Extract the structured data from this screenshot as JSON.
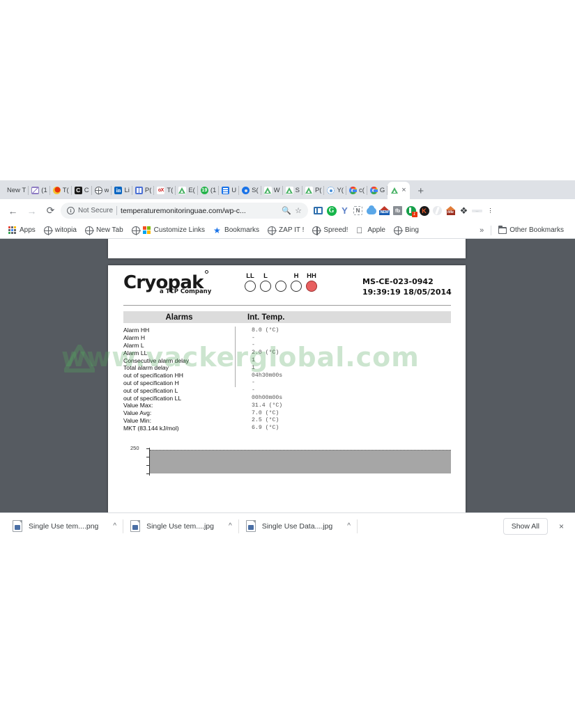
{
  "browser": {
    "tabs": [
      {
        "label": "New T",
        "icon": "none",
        "active": false
      },
      {
        "label": "(1",
        "icon": "mail-icon",
        "active": false
      },
      {
        "label": "T(",
        "icon": "red-dot-icon",
        "active": false
      },
      {
        "label": "C",
        "icon": "letter-c-icon",
        "active": false
      },
      {
        "label": "w",
        "icon": "globe-icon",
        "active": false
      },
      {
        "label": "Li",
        "icon": "linkedin-icon",
        "active": false
      },
      {
        "label": "P(",
        "icon": "blue-app-icon",
        "active": false
      },
      {
        "label": "T(",
        "icon": "ox-icon",
        "active": false
      },
      {
        "label": "E(",
        "icon": "green-triangle-icon",
        "active": false
      },
      {
        "label": "(1",
        "icon": "green-circle-icon",
        "active": false
      },
      {
        "label": "U",
        "icon": "document-icon",
        "active": false
      },
      {
        "label": "S(",
        "icon": "gear-icon",
        "active": false
      },
      {
        "label": "W",
        "icon": "green-triangle-icon",
        "active": false
      },
      {
        "label": "S",
        "icon": "green-triangle-icon",
        "active": false
      },
      {
        "label": "P(",
        "icon": "green-triangle-icon",
        "active": false
      },
      {
        "label": "Y(",
        "icon": "target-icon",
        "active": false
      },
      {
        "label": "c(",
        "icon": "google-icon",
        "active": false
      },
      {
        "label": "G",
        "icon": "google-icon",
        "active": false
      },
      {
        "label": "",
        "icon": "green-triangle-icon",
        "active": true
      }
    ],
    "tab_close_label": "×",
    "newtab_label": "+",
    "nav": {
      "back": "←",
      "forward": "→",
      "reload": "⟳"
    },
    "omnibox": {
      "security_label": "Not Secure",
      "url": "temperaturemonitoringuae.com/wp-c...",
      "zoom_icon": "zoom-out-icon",
      "bookmark_icon": "star-icon"
    },
    "extensions": [
      {
        "name": "blue-reader-icon"
      },
      {
        "name": "grammarly-icon",
        "label": "G"
      },
      {
        "name": "y-letter-icon",
        "label": "Y"
      },
      {
        "name": "notion-icon",
        "label": "N"
      },
      {
        "name": "cloud-icon"
      },
      {
        "name": "new-badge-icon",
        "label": "NEW"
      },
      {
        "name": "fb-icon",
        "label": "fb"
      },
      {
        "name": "q-badge-icon",
        "label": "1"
      },
      {
        "name": "k-circle-icon",
        "label": "K"
      },
      {
        "name": "swirl-icon"
      },
      {
        "name": "title-icon",
        "label": "title"
      },
      {
        "name": "puzzle-icon",
        "label": "❖"
      },
      {
        "name": "gray-bar-icon",
        "label": "-----"
      }
    ],
    "menu_label": "⋮",
    "bookmarks": [
      {
        "label": "Apps",
        "icon": "apps-grid-icon"
      },
      {
        "label": "witopia",
        "icon": "globe-icon"
      },
      {
        "label": "New Tab",
        "icon": "globe-icon"
      },
      {
        "label": "Customize Links",
        "icon": "microsoft-icon"
      },
      {
        "label": "Bookmarks",
        "icon": "star-icon"
      },
      {
        "label": "ZAP IT !",
        "icon": "globe-icon"
      },
      {
        "label": "Spreed!",
        "icon": "globe-icon"
      },
      {
        "label": "Apple",
        "icon": "apple-icon"
      },
      {
        "label": "Bing",
        "icon": "globe-icon"
      }
    ],
    "bookmarks_overflow": "»",
    "other_bookmarks": "Other Bookmarks"
  },
  "document": {
    "logo": {
      "brand": "Cryopa",
      "brand_k": "k",
      "tagline": "a TCP Company"
    },
    "leds": [
      {
        "label": "LL",
        "state": "off"
      },
      {
        "label": "L",
        "state": "off"
      },
      {
        "label": "",
        "state": "off"
      },
      {
        "label": "H",
        "state": "off"
      },
      {
        "label": "HH",
        "state": "on"
      }
    ],
    "led_on_color": "#e86060",
    "device_id": "MS-CE-023-0942",
    "timestamp": "19:39:19 18/05/2014",
    "table": {
      "header_left": "Alarms",
      "header_right": "Int. Temp.",
      "rows": [
        {
          "label": "Alarm HH",
          "value": "8.0 (°C)"
        },
        {
          "label": "Alarm H",
          "value": "-"
        },
        {
          "label": "Alarm L",
          "value": "-"
        },
        {
          "label": "Alarm LL",
          "value": "2.0 (°C)"
        },
        {
          "label": "Consecutive alarm delay",
          "value": "1"
        },
        {
          "label": "Total alarm delay",
          "value": "1"
        },
        {
          "label": "out of specification HH",
          "value": "04h30m00s"
        },
        {
          "label": "out of specification H",
          "value": "-"
        },
        {
          "label": "out of specification L",
          "value": "-"
        },
        {
          "label": "out of specification LL",
          "value": "00h00m00s"
        },
        {
          "label": "Value Max:",
          "value": "31.4 (°C)"
        },
        {
          "label": "Value Avg:",
          "value": "7.0 (°C)"
        },
        {
          "label": "Value Min:",
          "value": "2.5 (°C)"
        },
        {
          "label": "MKT (83.144 kJ/mol)",
          "value": "6.9 (°C)"
        }
      ]
    },
    "chart_axis_top_label": "250"
  },
  "chart_data": {
    "type": "line",
    "title": "",
    "xlabel": "",
    "ylabel": "",
    "yticks": [
      "250"
    ],
    "ylim": [
      0,
      250
    ],
    "grid": false,
    "note": "Top of a temperature/time plot, clipped by the viewport; only the top gridline label 250 and a gray plot band are visible."
  },
  "watermark": {
    "text": "www.vackerglobal.com",
    "color": "#56a85f"
  },
  "downloads": {
    "items": [
      {
        "filename": "Single Use tem....png",
        "menu": "^"
      },
      {
        "filename": "Single Use tem....jpg",
        "menu": "^"
      },
      {
        "filename": "Single Use Data....jpg",
        "menu": "^"
      }
    ],
    "show_all_label": "Show All",
    "close_label": "×"
  }
}
